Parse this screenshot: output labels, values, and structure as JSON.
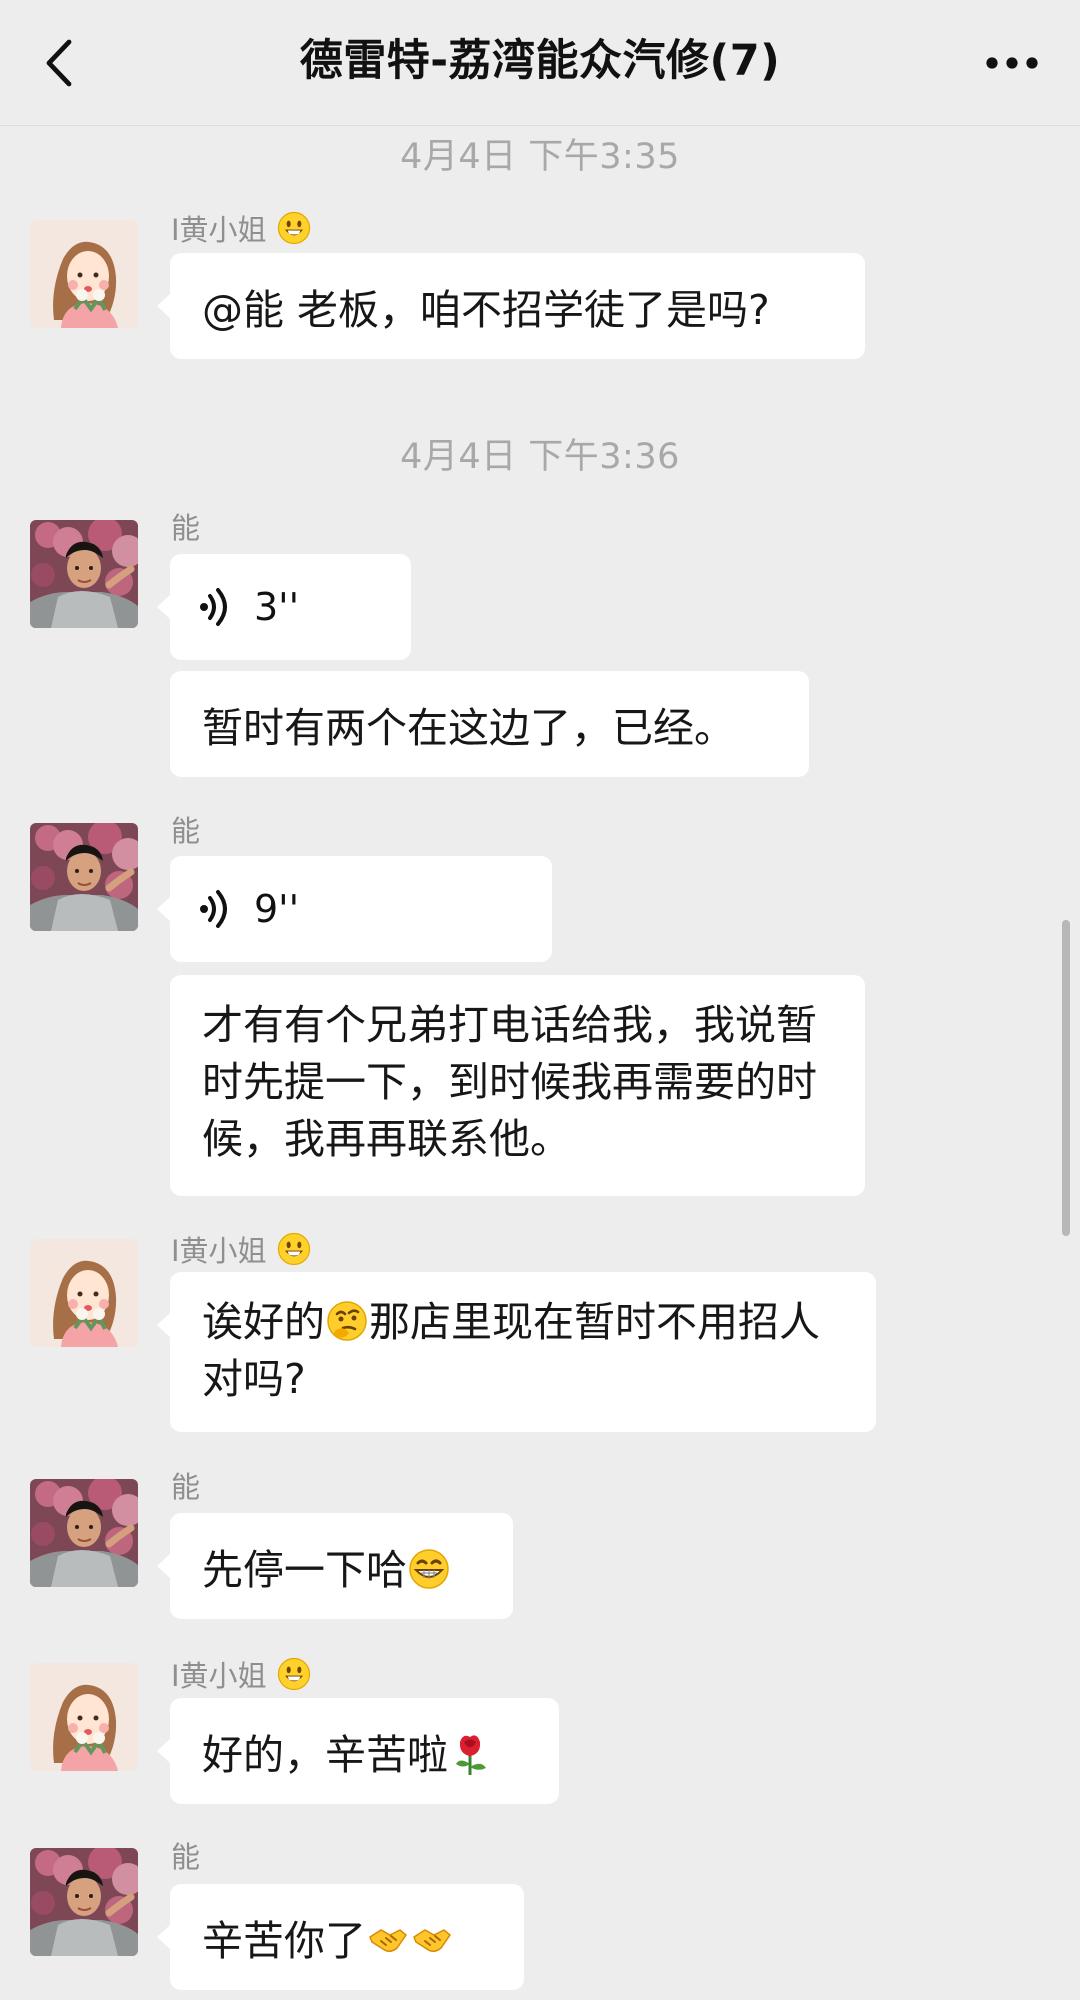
{
  "header": {
    "title": "德雷特-荔湾能众汽修(7)"
  },
  "timestamps": {
    "t1": "4月4日 下午3:35",
    "t2": "4月4日 下午3:36"
  },
  "senders": {
    "huang": "I黄小姐",
    "neng": "能"
  },
  "messages": {
    "m1": "@能 老板，咱不招学徒了是吗?",
    "m2": "3''",
    "m3": "暂时有两个在这边了，已经。",
    "m4": "9''",
    "m5": "才有有个兄弟打电话给我，我说暂时先提一下，到时候我再需要的时候，我再再联系他。",
    "m6a": "诶好的",
    "m6b": "那店里现在暂时不用招人对吗?",
    "m7": "先停一下哈",
    "m8": "好的，辛苦啦",
    "m9": "辛苦你了"
  },
  "icons": {
    "back": "chevron-left-icon",
    "more": "more-icon",
    "voice": "voice-wave-icon",
    "smile": "smile-emoji",
    "thinking": "thinking-emoji",
    "grin": "grin-emoji",
    "rose": "rose-emoji",
    "handshake": "handshake-emoji"
  }
}
